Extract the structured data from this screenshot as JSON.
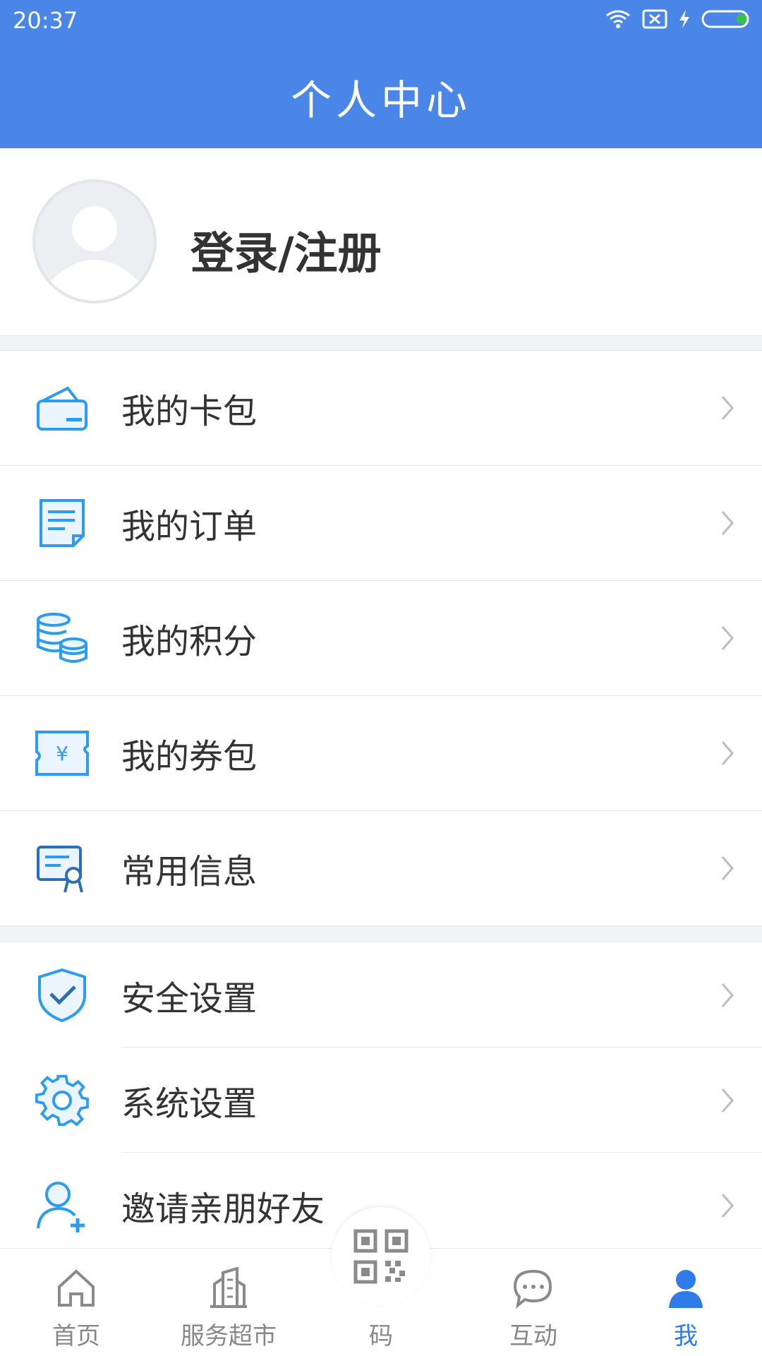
{
  "status": {
    "time": "20:37"
  },
  "header": {
    "title": "个人中心"
  },
  "profile": {
    "login_label": "登录/注册"
  },
  "menu_group_1": [
    {
      "label": "我的卡包",
      "icon": "wallet-icon"
    },
    {
      "label": "我的订单",
      "icon": "order-document-icon"
    },
    {
      "label": "我的积分",
      "icon": "points-coins-icon"
    },
    {
      "label": "我的券包",
      "icon": "coupon-icon"
    },
    {
      "label": "常用信息",
      "icon": "id-card-icon"
    }
  ],
  "menu_group_2": [
    {
      "label": "安全设置",
      "icon": "shield-check-icon"
    },
    {
      "label": "系统设置",
      "icon": "gear-icon"
    },
    {
      "label": "邀请亲朋好友",
      "icon": "add-user-icon"
    }
  ],
  "tabbar": {
    "items": [
      {
        "label": "首页",
        "icon": "home-icon"
      },
      {
        "label": "服务超市",
        "icon": "building-icon"
      },
      {
        "label": "码",
        "icon": "qr-code-icon"
      },
      {
        "label": "互动",
        "icon": "chat-icon"
      },
      {
        "label": "我",
        "icon": "person-icon",
        "active": true
      }
    ]
  },
  "colors": {
    "accent": "#4a86e8",
    "icon_blue": "#2d9cf0",
    "active_tab": "#2f7bea"
  }
}
